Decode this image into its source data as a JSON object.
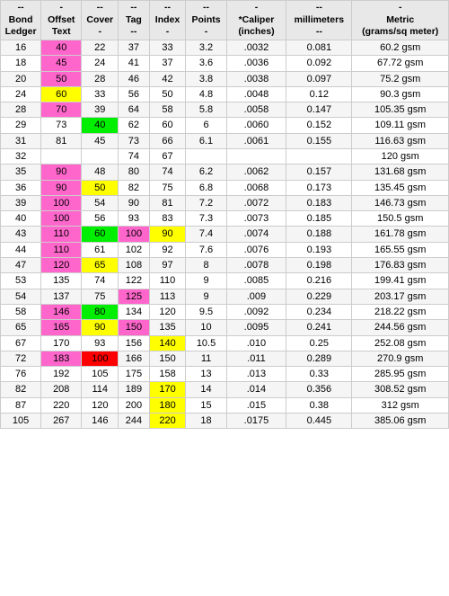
{
  "headers": {
    "bond": {
      "line1": "--",
      "line2": "Bond",
      "line3": "Ledger"
    },
    "offset": {
      "line1": "-",
      "line2": "Offset",
      "line3": "Text"
    },
    "cover": {
      "line1": "--",
      "line2": "Cover",
      "line3": "-"
    },
    "tag": {
      "line1": "--",
      "line2": "Tag",
      "line3": "--"
    },
    "index": {
      "line1": "--",
      "line2": "Index",
      "line3": "-"
    },
    "points": {
      "line1": "--",
      "line2": "Points",
      "line3": "-"
    },
    "caliper": {
      "line1": "-",
      "line2": "*Caliper",
      "line3": "(inches)"
    },
    "mm": {
      "line1": "--",
      "line2": "millimeters",
      "line3": "--"
    },
    "metric": {
      "line1": "-",
      "line2": "Metric",
      "line3": "(grams/sq meter)"
    }
  },
  "rows": [
    {
      "bond": "16",
      "offset": "40",
      "cover": "22",
      "tag": "37",
      "index": "33",
      "points": "3.2",
      "caliper": ".0032",
      "mm": "0.081",
      "metric": "60.2 gsm",
      "offsetColor": "#ff66cc",
      "coverColor": "",
      "tagColor": "",
      "indexColor": "",
      "pointsColor": ""
    },
    {
      "bond": "18",
      "offset": "45",
      "cover": "24",
      "tag": "41",
      "index": "37",
      "points": "3.6",
      "caliper": ".0036",
      "mm": "0.092",
      "metric": "67.72 gsm",
      "offsetColor": "#ff66cc",
      "coverColor": "",
      "tagColor": "",
      "indexColor": "",
      "pointsColor": ""
    },
    {
      "bond": "20",
      "offset": "50",
      "cover": "28",
      "tag": "46",
      "index": "42",
      "points": "3.8",
      "caliper": ".0038",
      "mm": "0.097",
      "metric": "75.2 gsm",
      "offsetColor": "#ff66cc",
      "coverColor": "",
      "tagColor": "",
      "indexColor": "",
      "pointsColor": ""
    },
    {
      "bond": "24",
      "offset": "60",
      "cover": "33",
      "tag": "56",
      "index": "50",
      "points": "4.8",
      "caliper": ".0048",
      "mm": "0.12",
      "metric": "90.3 gsm",
      "offsetColor": "#ffff00",
      "coverColor": "",
      "tagColor": "",
      "indexColor": "",
      "pointsColor": ""
    },
    {
      "bond": "28",
      "offset": "70",
      "cover": "39",
      "tag": "64",
      "index": "58",
      "points": "5.8",
      "caliper": ".0058",
      "mm": "0.147",
      "metric": "105.35 gsm",
      "offsetColor": "#ff66cc",
      "coverColor": "",
      "tagColor": "",
      "indexColor": "",
      "pointsColor": ""
    },
    {
      "bond": "29",
      "offset": "73",
      "cover": "40",
      "tag": "62",
      "index": "60",
      "points": "6",
      "caliper": ".0060",
      "mm": "0.152",
      "metric": "109.11 gsm",
      "offsetColor": "",
      "coverColor": "#00ee00",
      "tagColor": "",
      "indexColor": "",
      "pointsColor": ""
    },
    {
      "bond": "31",
      "offset": "81",
      "cover": "45",
      "tag": "73",
      "index": "66",
      "points": "6.1",
      "caliper": ".0061",
      "mm": "0.155",
      "metric": "116.63 gsm",
      "offsetColor": "",
      "coverColor": "",
      "tagColor": "",
      "indexColor": "",
      "pointsColor": ""
    },
    {
      "bond": "32",
      "offset": "",
      "cover": "",
      "tag": "74",
      "index": "67",
      "points": "",
      "caliper": "",
      "mm": "",
      "metric": "120 gsm",
      "offsetColor": "",
      "coverColor": "",
      "tagColor": "",
      "indexColor": "",
      "pointsColor": ""
    },
    {
      "bond": "35",
      "offset": "90",
      "cover": "48",
      "tag": "80",
      "index": "74",
      "points": "6.2",
      "caliper": ".0062",
      "mm": "0.157",
      "metric": "131.68 gsm",
      "offsetColor": "#ff66cc",
      "coverColor": "",
      "tagColor": "",
      "indexColor": "",
      "pointsColor": ""
    },
    {
      "bond": "36",
      "offset": "90",
      "cover": "50",
      "tag": "82",
      "index": "75",
      "points": "6.8",
      "caliper": ".0068",
      "mm": "0.173",
      "metric": "135.45 gsm",
      "offsetColor": "#ff66cc",
      "coverColor": "#ffff00",
      "tagColor": "",
      "indexColor": "",
      "pointsColor": ""
    },
    {
      "bond": "39",
      "offset": "100",
      "cover": "54",
      "tag": "90",
      "index": "81",
      "points": "7.2",
      "caliper": ".0072",
      "mm": "0.183",
      "metric": "146.73 gsm",
      "offsetColor": "#ff66cc",
      "coverColor": "",
      "tagColor": "",
      "indexColor": "",
      "pointsColor": ""
    },
    {
      "bond": "40",
      "offset": "100",
      "cover": "56",
      "tag": "93",
      "index": "83",
      "points": "7.3",
      "caliper": ".0073",
      "mm": "0.185",
      "metric": "150.5 gsm",
      "offsetColor": "#ff66cc",
      "coverColor": "",
      "tagColor": "",
      "indexColor": "",
      "pointsColor": ""
    },
    {
      "bond": "43",
      "offset": "110",
      "cover": "60",
      "tag": "100",
      "index": "90",
      "points": "7.4",
      "caliper": ".0074",
      "mm": "0.188",
      "metric": "161.78 gsm",
      "offsetColor": "#ff66cc",
      "coverColor": "#00ee00",
      "tagColor": "#ff66cc",
      "indexColor": "#ffff00",
      "pointsColor": ""
    },
    {
      "bond": "44",
      "offset": "110",
      "cover": "61",
      "tag": "102",
      "index": "92",
      "points": "7.6",
      "caliper": ".0076",
      "mm": "0.193",
      "metric": "165.55 gsm",
      "offsetColor": "#ff66cc",
      "coverColor": "",
      "tagColor": "",
      "indexColor": "",
      "pointsColor": ""
    },
    {
      "bond": "47",
      "offset": "120",
      "cover": "65",
      "tag": "108",
      "index": "97",
      "points": "8",
      "caliper": ".0078",
      "mm": "0.198",
      "metric": "176.83 gsm",
      "offsetColor": "#ff66cc",
      "coverColor": "#ffff00",
      "tagColor": "",
      "indexColor": "",
      "pointsColor": ""
    },
    {
      "bond": "53",
      "offset": "135",
      "cover": "74",
      "tag": "122",
      "index": "110",
      "points": "9",
      "caliper": ".0085",
      "mm": "0.216",
      "metric": "199.41 gsm",
      "offsetColor": "",
      "coverColor": "",
      "tagColor": "",
      "indexColor": "",
      "pointsColor": ""
    },
    {
      "bond": "54",
      "offset": "137",
      "cover": "75",
      "tag": "125",
      "index": "113",
      "points": "9",
      "caliper": ".009",
      "mm": "0.229",
      "metric": "203.17 gsm",
      "offsetColor": "",
      "coverColor": "",
      "tagColor": "#ff66cc",
      "indexColor": "",
      "pointsColor": ""
    },
    {
      "bond": "58",
      "offset": "146",
      "cover": "80",
      "tag": "134",
      "index": "120",
      "points": "9.5",
      "caliper": ".0092",
      "mm": "0.234",
      "metric": "218.22 gsm",
      "offsetColor": "#ff66cc",
      "coverColor": "#00ee00",
      "tagColor": "",
      "indexColor": "",
      "pointsColor": ""
    },
    {
      "bond": "65",
      "offset": "165",
      "cover": "90",
      "tag": "150",
      "index": "135",
      "points": "10",
      "caliper": ".0095",
      "mm": "0.241",
      "metric": "244.56 gsm",
      "offsetColor": "#ff66cc",
      "coverColor": "#ffff00",
      "tagColor": "#ff66cc",
      "indexColor": "",
      "pointsColor": ""
    },
    {
      "bond": "67",
      "offset": "170",
      "cover": "93",
      "tag": "156",
      "index": "140",
      "points": "10.5",
      "caliper": ".010",
      "mm": "0.25",
      "metric": "252.08 gsm",
      "offsetColor": "",
      "coverColor": "",
      "tagColor": "",
      "indexColor": "#ffff00",
      "pointsColor": ""
    },
    {
      "bond": "72",
      "offset": "183",
      "cover": "100",
      "tag": "166",
      "index": "150",
      "points": "11",
      "caliper": ".011",
      "mm": "0.289",
      "metric": "270.9 gsm",
      "offsetColor": "#ff66cc",
      "coverColor": "#ff0000",
      "tagColor": "",
      "indexColor": "",
      "pointsColor": ""
    },
    {
      "bond": "76",
      "offset": "192",
      "cover": "105",
      "tag": "175",
      "index": "158",
      "points": "13",
      "caliper": ".013",
      "mm": "0.33",
      "metric": "285.95 gsm",
      "offsetColor": "",
      "coverColor": "",
      "tagColor": "",
      "indexColor": "",
      "pointsColor": ""
    },
    {
      "bond": "82",
      "offset": "208",
      "cover": "114",
      "tag": "189",
      "index": "170",
      "points": "14",
      "caliper": ".014",
      "mm": "0.356",
      "metric": "308.52 gsm",
      "offsetColor": "",
      "coverColor": "",
      "tagColor": "",
      "indexColor": "#ffff00",
      "pointsColor": ""
    },
    {
      "bond": "87",
      "offset": "220",
      "cover": "120",
      "tag": "200",
      "index": "180",
      "points": "15",
      "caliper": ".015",
      "mm": "0.38",
      "metric": "312 gsm",
      "offsetColor": "",
      "coverColor": "",
      "tagColor": "",
      "indexColor": "#ffff00",
      "pointsColor": ""
    },
    {
      "bond": "105",
      "offset": "267",
      "cover": "146",
      "tag": "244",
      "index": "220",
      "points": "18",
      "caliper": ".0175",
      "mm": "0.445",
      "metric": "385.06 gsm",
      "offsetColor": "",
      "coverColor": "",
      "tagColor": "",
      "indexColor": "#ffff00",
      "pointsColor": ""
    }
  ]
}
